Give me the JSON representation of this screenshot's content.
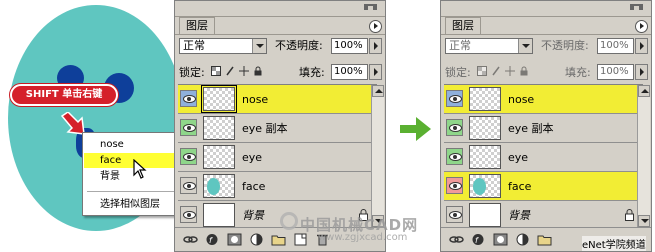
{
  "illustration": {
    "shift_badge": "SHIFT 单击右键",
    "context_menu": {
      "items": [
        {
          "label": "nose",
          "selected": false
        },
        {
          "label": "face",
          "selected": true
        },
        {
          "label": "背景",
          "selected": false
        }
      ],
      "footer_item": "选择相似图层"
    },
    "colors": {
      "face": "#5fc6c0",
      "features": "#0e3f9a",
      "badge": "#d5202a",
      "highlight": "#ffff33"
    }
  },
  "panels": [
    {
      "tab": "图层",
      "blend_mode": "正常",
      "opacity_label": "不透明度:",
      "opacity_value": "100%",
      "lock_label": "锁定:",
      "fill_label": "填充:",
      "fill_value": "100%",
      "layers": [
        {
          "name": "nose",
          "selected": true,
          "eye_style": "sel-blue"
        },
        {
          "name": "eye 副本",
          "selected": false,
          "eye_style": "link-green"
        },
        {
          "name": "eye",
          "selected": false,
          "eye_style": "link-green"
        },
        {
          "name": "face",
          "selected": false,
          "eye_style": "plain"
        },
        {
          "name": "背景",
          "selected": false,
          "eye_style": "plain",
          "locked": true
        }
      ]
    },
    {
      "tab": "图层",
      "blend_mode": "正常",
      "opacity_label": "不透明度:",
      "opacity_value": "100%",
      "lock_label": "锁定:",
      "fill_label": "填充:",
      "fill_value": "100%",
      "layers": [
        {
          "name": "nose",
          "selected": true,
          "eye_style": "sel-blue"
        },
        {
          "name": "eye 副本",
          "selected": false,
          "eye_style": "link-green"
        },
        {
          "name": "eye",
          "selected": false,
          "eye_style": "link-green"
        },
        {
          "name": "face",
          "selected": true,
          "eye_style": "link-red"
        },
        {
          "name": "背景",
          "selected": false,
          "eye_style": "plain",
          "locked": true
        }
      ]
    }
  ],
  "watermark": {
    "title": "中国机械CAD网",
    "url": "www.zgjxcad.com",
    "corner_mark": "eNet学院频道"
  }
}
